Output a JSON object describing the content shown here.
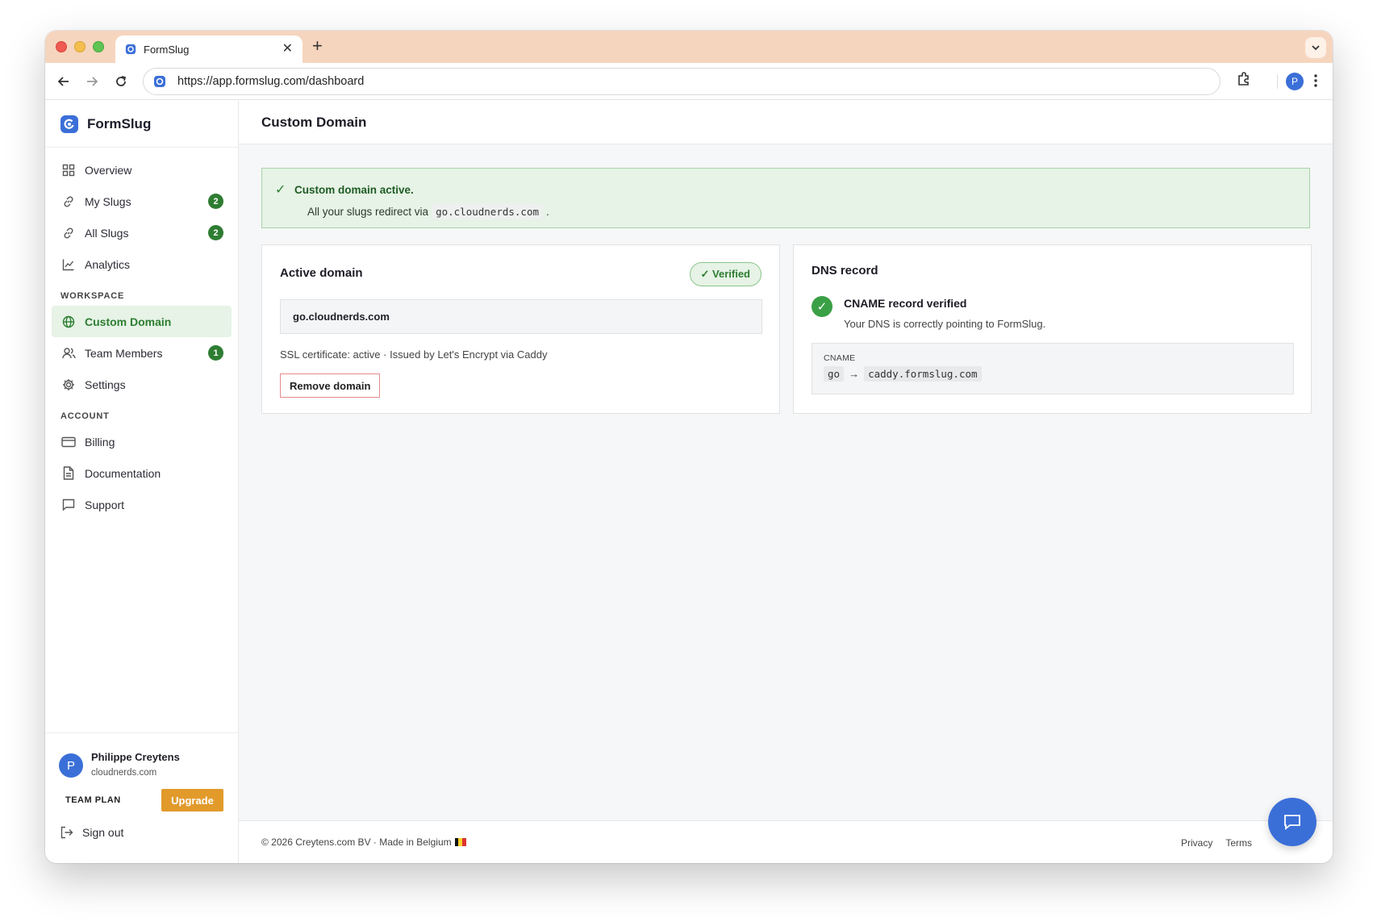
{
  "browser": {
    "tab_title": "FormSlug",
    "url": "https://app.formslug.com/dashboard",
    "profile_initial": "P"
  },
  "sidebar": {
    "brand": "FormSlug",
    "main_items": [
      {
        "label": "Overview",
        "icon": "grid-icon"
      },
      {
        "label": "My Slugs",
        "icon": "link-icon",
        "badge": "2"
      },
      {
        "label": "All Slugs",
        "icon": "link-icon",
        "badge": "2"
      },
      {
        "label": "Analytics",
        "icon": "chart-icon"
      }
    ],
    "workspace_heading": "WORKSPACE",
    "workspace_items": [
      {
        "label": "Custom Domain",
        "icon": "globe-icon",
        "active": true
      },
      {
        "label": "Team Members",
        "icon": "users-icon",
        "badge": "1"
      },
      {
        "label": "Settings",
        "icon": "gear-icon"
      }
    ],
    "account_heading": "ACCOUNT",
    "account_items": [
      {
        "label": "Billing",
        "icon": "card-icon"
      },
      {
        "label": "Documentation",
        "icon": "document-icon"
      },
      {
        "label": "Support",
        "icon": "chat-icon"
      }
    ],
    "user": {
      "initial": "P",
      "name": "Philippe Creytens",
      "org": "cloudnerds.com"
    },
    "plan": "TEAM PLAN",
    "upgrade_label": "Upgrade",
    "signout_label": "Sign out"
  },
  "main": {
    "title": "Custom Domain",
    "alert": {
      "title": "Custom domain active.",
      "message_prefix": "All your slugs redirect via",
      "domain": "go.cloudnerds.com",
      "message_suffix": "."
    },
    "active_domain": {
      "title": "Active domain",
      "badge": "✓ Verified",
      "domain": "go.cloudnerds.com",
      "ssl": "SSL certificate: active · Issued by Let's Encrypt via Caddy",
      "remove_label": "Remove domain"
    },
    "dns": {
      "title": "DNS record",
      "status_title": "CNAME record verified",
      "status_sub": "Your DNS is correctly pointing to FormSlug.",
      "record_type": "CNAME",
      "host": "go",
      "arrow": "→",
      "target": "caddy.formslug.com"
    }
  },
  "footer": {
    "copyright": "© 2026 Creytens.com BV · Made in Belgium",
    "links": [
      "Privacy",
      "Terms"
    ]
  },
  "colors": {
    "accent_green": "#2e7d32",
    "brand_blue": "#3b6fd8",
    "upgrade_orange": "#e29a2b",
    "tabbar": "#f6d5be"
  }
}
